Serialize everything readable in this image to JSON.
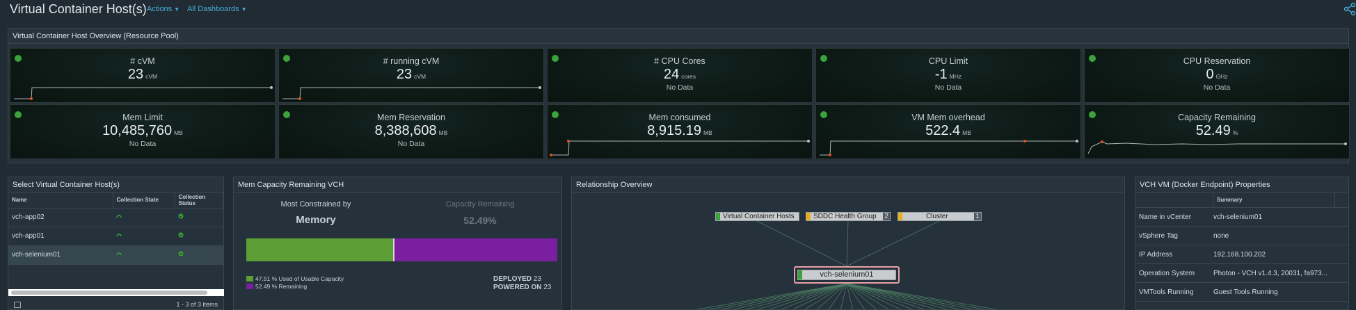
{
  "header": {
    "title": "Virtual Container Host(s)",
    "actions_label": "Actions",
    "dashboards_label": "All Dashboards"
  },
  "overview": {
    "title": "Virtual Container Host Overview (Resource Pool)",
    "tiles": [
      {
        "label": "# cVM",
        "value": "23",
        "unit": "cVM",
        "nodata": ""
      },
      {
        "label": "# running cVM",
        "value": "23",
        "unit": "cVM",
        "nodata": ""
      },
      {
        "label": "# CPU Cores",
        "value": "24",
        "unit": "cores",
        "nodata": "No Data"
      },
      {
        "label": "CPU Limit",
        "value": "-1",
        "unit": "MHz",
        "nodata": "No Data"
      },
      {
        "label": "CPU Reservation",
        "value": "0",
        "unit": "GHz",
        "nodata": "No Data"
      },
      {
        "label": "Mem Limit",
        "value": "10,485,760",
        "unit": "MB",
        "nodata": "No Data"
      },
      {
        "label": "Mem Reservation",
        "value": "8,388,608",
        "unit": "MB",
        "nodata": "No Data"
      },
      {
        "label": "Mem consumed",
        "value": "8,915.19",
        "unit": "MB",
        "nodata": ""
      },
      {
        "label": "VM Mem overhead",
        "value": "522.4",
        "unit": "MB",
        "nodata": ""
      },
      {
        "label": "Capacity Remaining",
        "value": "52.49",
        "unit": "%",
        "nodata": ""
      }
    ],
    "status_color": "#3ca33c"
  },
  "vch_list": {
    "title": "Select Virtual Container Host(s)",
    "columns": [
      "Name",
      "Collection State",
      "Collection Status"
    ],
    "rows": [
      {
        "name": "vch-app02"
      },
      {
        "name": "vch-app01"
      },
      {
        "name": "vch-selenium01"
      }
    ],
    "selected_index": 2,
    "footer": "1 - 3 of 3 items"
  },
  "mem_capacity": {
    "title": "Mem Capacity Remaining VCH",
    "most_constrained_label": "Most Constrained by",
    "most_constrained_value": "Memory",
    "capacity_remaining_label": "Capacity Remaining",
    "capacity_remaining_value": "52.49%",
    "used_pct": 47.51,
    "remaining_pct": 52.49,
    "legend_used": "47.51 % Used of Usable Capacity",
    "legend_remaining": "52.49 % Remaining",
    "deployed_label": "DEPLOYED",
    "deployed_value": "23",
    "powered_on_label": "POWERED ON",
    "powered_on_value": "23",
    "used_color": "#5e9e36",
    "remaining_color": "#7a1fa0"
  },
  "relationship": {
    "title": "Relationship Overview",
    "nodes": [
      {
        "label": "Virtual Container Hosts",
        "count": ""
      },
      {
        "label": "SDDC Health Group",
        "count": "2"
      },
      {
        "label": "Cluster",
        "count": "1"
      }
    ],
    "center_node": "vch-selenium01"
  },
  "properties": {
    "title": "VCH VM (Docker Endpoint) Properties",
    "column_summary": "Summary",
    "rows": [
      {
        "key": "Name in vCenter",
        "value": "vch-selenium01"
      },
      {
        "key": "vSphere Tag",
        "value": "none"
      },
      {
        "key": "IP Address",
        "value": "192.168.100.202"
      },
      {
        "key": "Operation System",
        "value": "Photon - VCH v1.4.3, 20031, fa973..."
      },
      {
        "key": "VMTools Running",
        "value": "Guest Tools Running"
      }
    ]
  }
}
